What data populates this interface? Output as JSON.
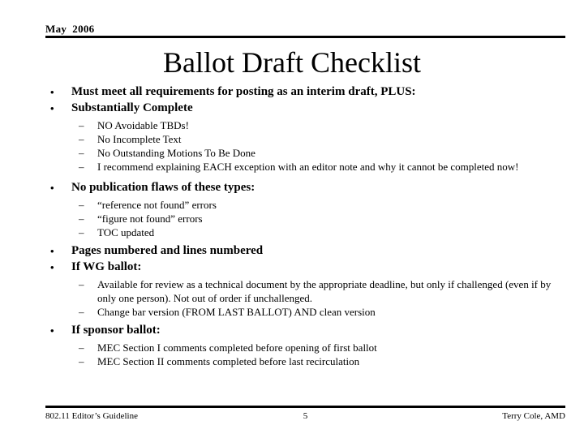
{
  "header": {
    "date": "May  2006"
  },
  "title": "Ballot Draft Checklist",
  "body": {
    "b1": "Must meet all requirements for posting as an interim draft, PLUS:",
    "b2": "Substantially Complete",
    "b2_sub": [
      "NO Avoidable TBDs!",
      "No Incomplete Text",
      "No Outstanding Motions To Be Done",
      "I recommend explaining EACH exception with an editor note and why it cannot be completed now!"
    ],
    "b3": "No publication flaws of these types:",
    "b3_sub": [
      "“reference not found” errors",
      "“figure not found” errors",
      "TOC updated"
    ],
    "b4": "Pages numbered and lines numbered",
    "b5": "If WG ballot:",
    "b5_sub": [
      "Available for review as a technical document by the appropriate deadline, but only if challenged (even if by only one person). Not out of order if unchallenged.",
      "Change bar version (FROM LAST BALLOT) AND clean version"
    ],
    "b6": "If sponsor ballot:",
    "b6_sub": [
      "MEC Section I comments completed before opening of first ballot",
      "MEC Section II comments completed before last recirculation"
    ]
  },
  "markers": {
    "level1": "•",
    "level2": "–"
  },
  "footer": {
    "left": "802.11 Editor’s Guideline",
    "center": "5",
    "right": "Terry Cole, AMD"
  },
  "colors": {
    "text": "#000000",
    "background": "#ffffff",
    "rule": "#000000"
  }
}
